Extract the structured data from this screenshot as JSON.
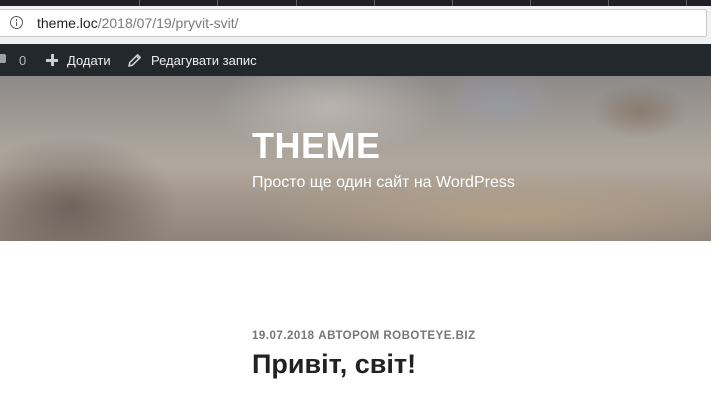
{
  "browser": {
    "url_host": "theme.loc",
    "url_path": "/2018/07/19/pryvit-svit/",
    "icons": {
      "site_info": "info-icon"
    }
  },
  "admin_bar": {
    "comment_count": "0",
    "add_label": "Додати",
    "edit_label": "Редагувати запис",
    "icons": {
      "comments": "comment-icon",
      "add": "plus-icon",
      "edit": "pencil-icon"
    }
  },
  "header": {
    "site_title": "THEME",
    "site_description": "Просто ще один сайт на WordPress"
  },
  "post": {
    "date": "19.07.2018",
    "author_prefix": "АВТОРОМ",
    "author": "ROBOTEYE.BIZ",
    "title": "Привіт, світ!"
  },
  "colors": {
    "admin_bar_bg": "#23282d",
    "admin_bar_text": "#eeeeee",
    "meta_text": "#767676",
    "title_text": "#222222"
  }
}
